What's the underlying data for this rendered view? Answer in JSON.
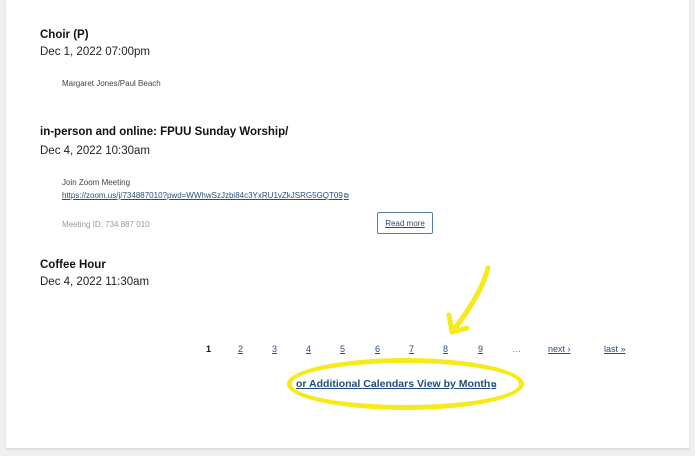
{
  "events": [
    {
      "title": "Choir (P)",
      "date": "Dec 1, 2022 07:00pm",
      "detail": "Margaret Jones/Paul Beach"
    },
    {
      "title": "in-person and online: FPUU Sunday Worship/",
      "date": "Dec 4, 2022 10:30am",
      "detail": "Join Zoom Meeting",
      "link": "https://zoom.us/j/734887010?pwd=WWhwSzJzbi84c3YxRU1vZkJSRG5GQT09",
      "meeting_id": "Meeting ID: 734 887 010",
      "read_more": "Read more"
    },
    {
      "title": "Coffee Hour",
      "date": "Dec 4, 2022 11:30am"
    }
  ],
  "pager": {
    "current": "1",
    "pages": [
      "2",
      "3",
      "4",
      "5",
      "6",
      "7",
      "8",
      "9"
    ],
    "ellipsis": "…",
    "next": "next ›",
    "last": "last »"
  },
  "calendars_link": "or Additional Calendars View by Month",
  "annotation": {
    "highlight_color": "#f7ea1a"
  }
}
